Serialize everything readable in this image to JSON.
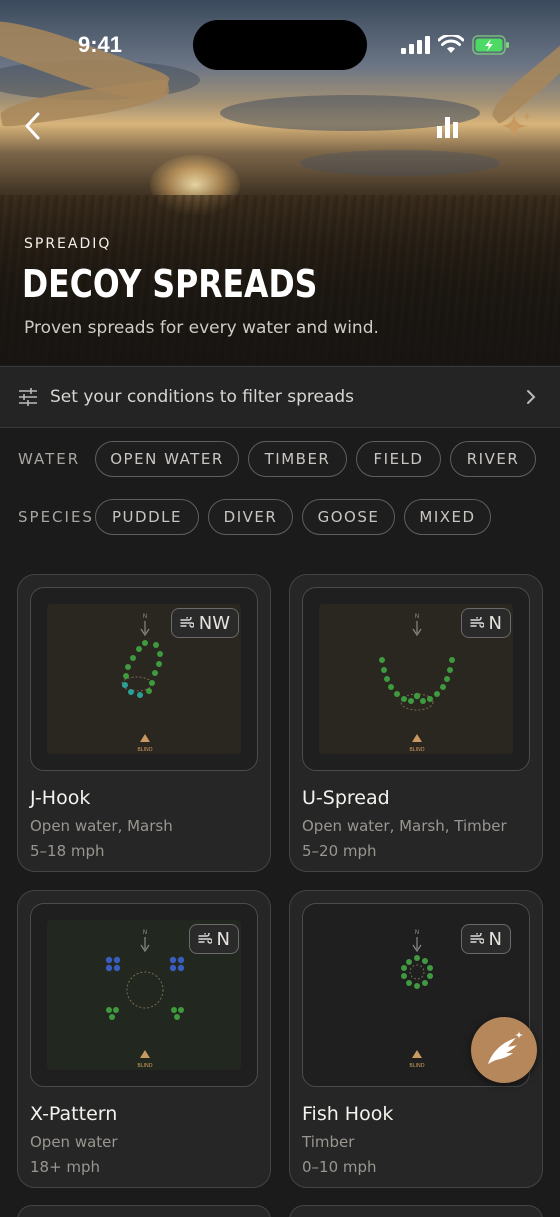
{
  "status_bar": {
    "time": "9:41"
  },
  "hero": {
    "eyebrow": "SPREADIQ",
    "title": "DECOY SPREADS",
    "subtitle": "Proven spreads for every water and wind."
  },
  "filter_bar": {
    "label": "Set your conditions to filter spreads"
  },
  "filters": {
    "water_label": "WATER",
    "water": [
      "OPEN WATER",
      "TIMBER",
      "FIELD",
      "RIVER"
    ],
    "species_label": "SPECIES",
    "species": [
      "PUDDLE",
      "DIVER",
      "GOOSE",
      "MIXED"
    ]
  },
  "diagram_labels": {
    "north": "N",
    "blind": "BLIND"
  },
  "cards": [
    {
      "name": "J-Hook",
      "meta": "Open water, Marsh",
      "speed": "5–18 mph",
      "wind": "NW"
    },
    {
      "name": "U-Spread",
      "meta": "Open water, Marsh, Timber",
      "speed": "5–20 mph",
      "wind": "N"
    },
    {
      "name": "X-Pattern",
      "meta": "Open water",
      "speed": "18+ mph",
      "wind": "N"
    },
    {
      "name": "Fish Hook",
      "meta": "Timber",
      "speed": "0–10 mph",
      "wind": "N"
    }
  ],
  "colors": {
    "accent": "#b5875a",
    "puddle_decoy": "#3f9a3f",
    "teal_decoy": "#2aa198",
    "diver_decoy": "#3b5bbf",
    "blind": "#c89a5f"
  }
}
